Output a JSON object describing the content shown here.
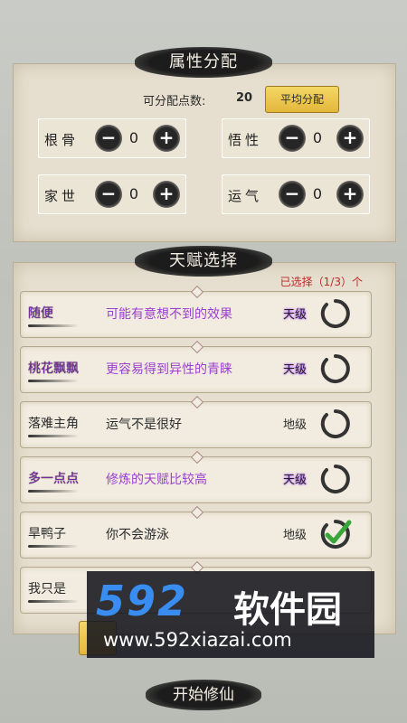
{
  "attributes": {
    "title": "属性分配",
    "points_label": "可分配点数:",
    "points_value": "20",
    "average_button": "平均分配",
    "items": [
      {
        "name": "根骨",
        "value": "0"
      },
      {
        "name": "悟性",
        "value": "0"
      },
      {
        "name": "家世",
        "value": "0"
      },
      {
        "name": "运气",
        "value": "0"
      }
    ],
    "minus": "−",
    "plus": "+"
  },
  "talents": {
    "title": "天赋选择",
    "selected_text": "已选择（1/3）个",
    "items": [
      {
        "name": "随便",
        "desc": "可能有意想不到的效果",
        "grade": "天级",
        "checked": false
      },
      {
        "name": "桃花飘飘",
        "desc": "更容易得到异性的青睐",
        "grade": "天级",
        "checked": false
      },
      {
        "name": "落难主角",
        "desc": "运气不是很好",
        "grade": "地级",
        "checked": false
      },
      {
        "name": "多一点点",
        "desc": "修炼的天赋比较高",
        "grade": "天级",
        "checked": false
      },
      {
        "name": "旱鸭子",
        "desc": "你不会游泳",
        "grade": "地级",
        "checked": true
      },
      {
        "name": "我只是",
        "desc": "",
        "grade": "",
        "checked": false
      }
    ]
  },
  "start_button": "开始修仙",
  "watermark": {
    "logo_number": "592",
    "logo_text": "软件园",
    "url": "www.592xiazai.com"
  },
  "colors": {
    "purple_desc": "#9b3fd0",
    "check_green": "#3aa63a",
    "accent_gold": "#e4b73c",
    "selected_red": "#c12828"
  }
}
